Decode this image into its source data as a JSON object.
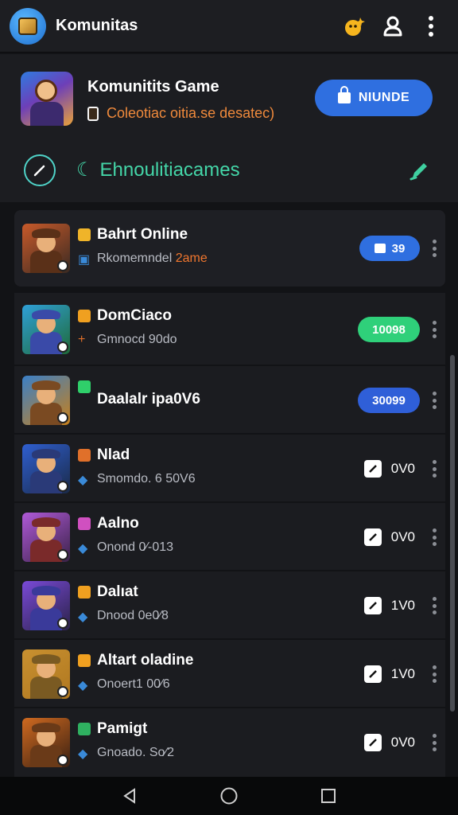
{
  "appbar": {
    "title": "Komunitas",
    "icons": [
      "app-logo-icon",
      "notification-sparkle-icon",
      "profile-icon",
      "more-vert-icon"
    ]
  },
  "header": {
    "game_title": "Komunitits Game",
    "subtitle": "Coleotiac oitia.se desatec)",
    "unlock_label": "NIUNDE",
    "section_title": "Ehnoulitiacames"
  },
  "games": [
    {
      "name": "Bahrt Online",
      "sub_prefix": "Rkomemndel",
      "sub_highlight": "2ame",
      "action_type": "pill",
      "action_label": "39",
      "action_color": "#2f6fe0",
      "icon_color": "#f0b429"
    },
    {
      "name": "DomCiaco",
      "sub_prefix": "Gmnocd 90do",
      "sub_highlight": "",
      "action_type": "pill",
      "action_label": "10098",
      "action_color": "#2fd07a",
      "icon_color": "#f0a020"
    },
    {
      "name": "Daalalr ipa0V6",
      "sub_prefix": "",
      "sub_highlight": "",
      "action_type": "pill",
      "action_label": "30099",
      "action_color": "#2f5fd8",
      "icon_color": "#2fcf6a"
    },
    {
      "name": "Nlad",
      "sub_prefix": "Smomdo. 6 50V6",
      "sub_highlight": "",
      "action_type": "count",
      "action_label": "0V0",
      "action_color": "",
      "icon_color": "#e0702a"
    },
    {
      "name": "Aalno",
      "sub_prefix": "Onond 0⁄-013",
      "sub_highlight": "",
      "action_type": "count",
      "action_label": "0V0",
      "action_color": "",
      "icon_color": "#d050c0"
    },
    {
      "name": "Dalıat",
      "sub_prefix": "Dnood 0e0⁄8",
      "sub_highlight": "",
      "action_type": "count",
      "action_label": "1V0",
      "action_color": "",
      "icon_color": "#f0a020"
    },
    {
      "name": "Altart oladine",
      "sub_prefix": "Onoert1 00⁄6",
      "sub_highlight": "",
      "action_type": "count",
      "action_label": "1V0",
      "action_color": "",
      "icon_color": "#f0a020"
    },
    {
      "name": "Pamigt",
      "sub_prefix": "Gnoado. So⁄2",
      "sub_highlight": "",
      "action_type": "count",
      "action_label": "0V0",
      "action_color": "",
      "icon_color": "#2fb060"
    }
  ],
  "navbar": {
    "icons": [
      "back-icon",
      "home-icon",
      "recents-icon"
    ]
  }
}
